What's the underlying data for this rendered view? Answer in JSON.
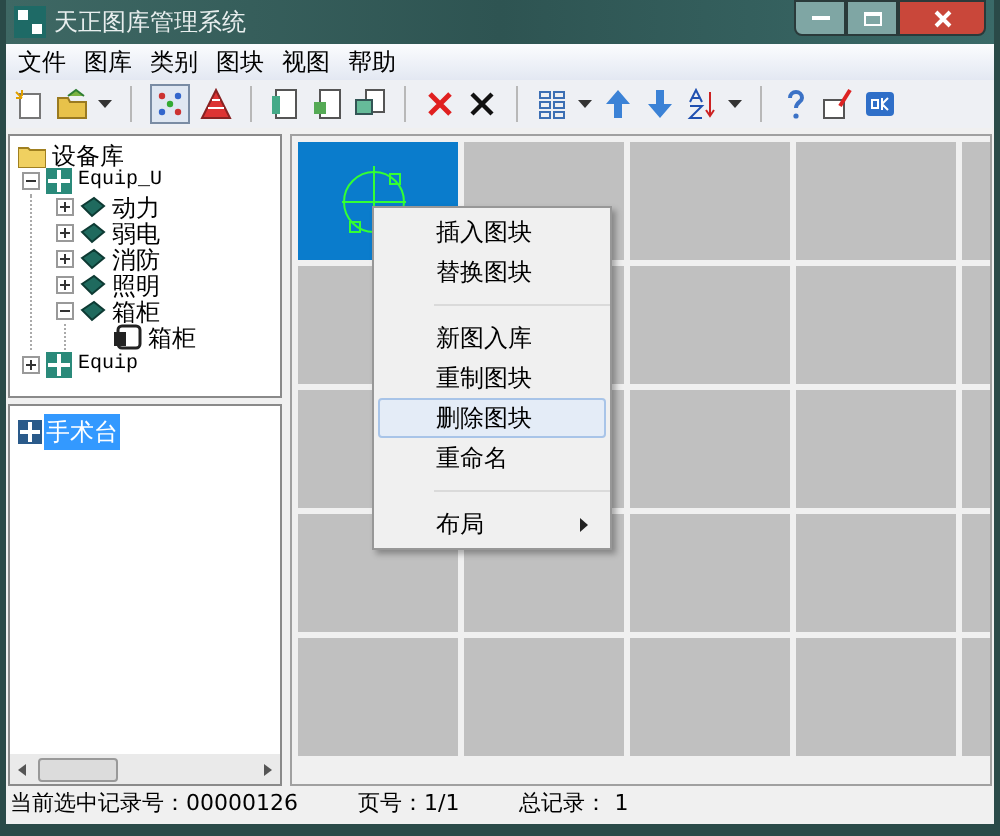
{
  "window": {
    "title": "天正图库管理系统"
  },
  "menu": [
    "文件",
    "图库",
    "类别",
    "图块",
    "视图",
    "帮助"
  ],
  "tree": [
    {
      "label": "设备库",
      "kind": "root",
      "expanded": true,
      "children": [
        {
          "label": "Equip_U",
          "kind": "library",
          "expanded": true,
          "children": [
            {
              "label": "动力",
              "kind": "category",
              "expanded": false
            },
            {
              "label": "弱电",
              "kind": "category",
              "expanded": false
            },
            {
              "label": "消防",
              "kind": "category",
              "expanded": false
            },
            {
              "label": "照明",
              "kind": "category",
              "expanded": false
            },
            {
              "label": "箱柜",
              "kind": "category",
              "expanded": true,
              "children": [
                {
                  "label": "箱柜",
                  "kind": "page"
                }
              ]
            }
          ]
        },
        {
          "label": "Equip",
          "kind": "library",
          "expanded": false
        }
      ]
    }
  ],
  "page_list": [
    {
      "label": "手术台",
      "selected": true
    }
  ],
  "blocks": [
    {
      "selected": true
    },
    {
      "selected": false
    },
    {
      "selected": false
    },
    {
      "selected": false
    },
    {
      "selected": false
    },
    {
      "selected": false
    },
    {
      "selected": false
    },
    {
      "selected": false
    },
    {
      "selected": false
    },
    {
      "selected": false
    },
    {
      "selected": false
    },
    {
      "selected": false
    },
    {
      "selected": false
    },
    {
      "selected": false
    },
    {
      "selected": false
    },
    {
      "selected": false
    },
    {
      "selected": false
    },
    {
      "selected": false
    },
    {
      "selected": false
    },
    {
      "selected": false
    },
    {
      "selected": false
    },
    {
      "selected": false
    },
    {
      "selected": false
    },
    {
      "selected": false
    },
    {
      "selected": false
    }
  ],
  "context_menu": [
    {
      "label": "插入图块",
      "kind": "item",
      "selected": false
    },
    {
      "label": "替换图块",
      "kind": "item",
      "selected": false
    },
    {
      "kind": "separator"
    },
    {
      "label": "新图入库",
      "kind": "item",
      "selected": false
    },
    {
      "label": "重制图块",
      "kind": "item",
      "selected": false
    },
    {
      "label": "删除图块",
      "kind": "item",
      "selected": true
    },
    {
      "label": "重命名",
      "kind": "item",
      "selected": false
    },
    {
      "kind": "separator"
    },
    {
      "label": "布局",
      "kind": "submenu",
      "selected": false
    }
  ],
  "status_bar": [
    "当前选中记录号：00000126",
    "页号：1/1",
    "总记录： 1"
  ]
}
